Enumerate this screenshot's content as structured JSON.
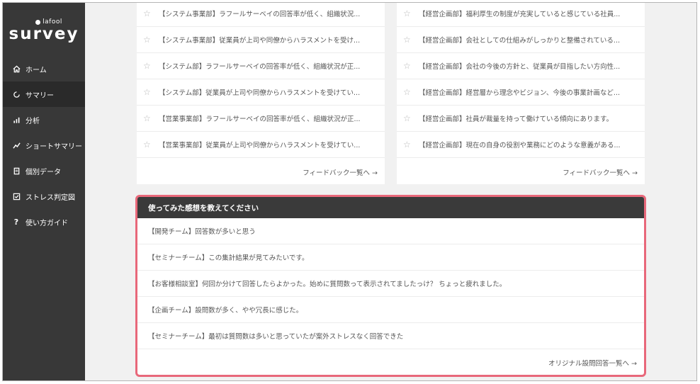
{
  "app": {
    "logo_sub": "lafool",
    "logo_main": "survey"
  },
  "sidebar": {
    "items": [
      {
        "label": "ホーム",
        "icon": "home-icon"
      },
      {
        "label": "サマリー",
        "icon": "refresh-icon"
      },
      {
        "label": "分析",
        "icon": "bar-chart-icon"
      },
      {
        "label": "ショートサマリー",
        "icon": "trend-icon"
      },
      {
        "label": "個別データ",
        "icon": "document-icon"
      },
      {
        "label": "ストレス判定図",
        "icon": "checkbox-icon"
      },
      {
        "label": "使い方ガイド",
        "icon": "question-icon"
      }
    ],
    "active_index": 1
  },
  "left_card": {
    "rows": [
      "【システム事業部】ラフールサーベイの回答率が低く、組織状況...",
      "【システム事業部】従業員が上司や同僚からハラスメントを受け...",
      "【システム部】ラフールサーベイの回答率が低く、組織状況が正...",
      "【システム部】従業員が上司や同僚からハラスメントを受けてい...",
      "【営業事業部】ラフールサーベイの回答率が低く、組織状況が正...",
      "【営業事業部】従業員が上司や同僚からハラスメントを受けてい..."
    ],
    "link": "フィードバック一覧へ →"
  },
  "right_card": {
    "rows": [
      "【経営企画部】福利厚生の制度が充実していると感じている社員...",
      "【経営企画部】会社としての仕組みがしっかりと整備されている...",
      "【経営企画部】会社の今後の方針と、従業員が目指したい方向性...",
      "【経営企画部】経営層から理念やビジョン、今後の事業計画など...",
      "【経営企画部】社員が裁量を持って働けている傾向にあります。",
      "【経営企画部】現在の自身の役割や業務にどのような意義がある..."
    ],
    "link": "フィードバック一覧へ →"
  },
  "feedback_panel": {
    "title": "使ってみた感想を教えてください",
    "rows": [
      "【開発チーム】回答数が多いと思う",
      "【セミナーチーム】この集計結果が見てみたいです。",
      "【お客様相談室】何回か分けて回答したらよかった。始めに質問数って表示されてましたっけ？ ちょっと疲れました。",
      "【企画チーム】設問数が多く、やや冗長に感じた。",
      "【セミナーチーム】最初は質問数は多いと思っていたが案外ストレスなく回答できた"
    ],
    "link": "オリジナル設問回答一覧へ →"
  },
  "colors": {
    "sidebar": "#383838",
    "highlight_border": "#e8687a",
    "panel_header": "#3a3a3a"
  }
}
